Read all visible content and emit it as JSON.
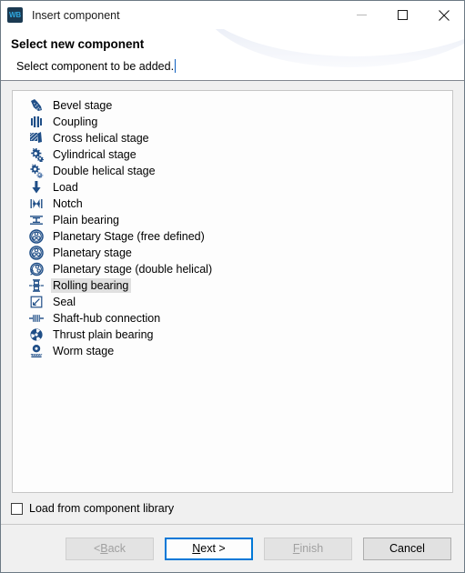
{
  "window": {
    "title": "Insert component",
    "app_icon_text": "WB",
    "controls": [
      {
        "name": "minimize",
        "glyph": "minimize-icon",
        "enabled": false
      },
      {
        "name": "maximize",
        "glyph": "maximize-icon",
        "enabled": true
      },
      {
        "name": "close",
        "glyph": "close-icon",
        "enabled": true
      }
    ]
  },
  "header": {
    "title": "Select new component",
    "subtitle": "Select component to be added."
  },
  "list": {
    "selected_index": 11,
    "items": [
      {
        "label": "Bevel stage",
        "icon": "bevel-gear-icon"
      },
      {
        "label": "Coupling",
        "icon": "coupling-icon"
      },
      {
        "label": "Cross helical stage",
        "icon": "cross-helical-gear-icon"
      },
      {
        "label": "Cylindrical stage",
        "icon": "cylindrical-gear-icon"
      },
      {
        "label": "Double helical stage",
        "icon": "double-helical-gear-icon"
      },
      {
        "label": "Load",
        "icon": "load-arrow-icon"
      },
      {
        "label": "Notch",
        "icon": "notch-icon"
      },
      {
        "label": "Plain bearing",
        "icon": "plain-bearing-icon"
      },
      {
        "label": "Planetary Stage (free defined)",
        "icon": "planetary-stage-icon"
      },
      {
        "label": "Planetary stage",
        "icon": "planetary-stage-icon"
      },
      {
        "label": "Planetary stage (double helical)",
        "icon": "planetary-double-helical-icon"
      },
      {
        "label": "Rolling bearing",
        "icon": "rolling-bearing-icon"
      },
      {
        "label": "Seal",
        "icon": "seal-icon"
      },
      {
        "label": "Shaft-hub connection",
        "icon": "shaft-hub-connection-icon"
      },
      {
        "label": "Thrust plain bearing",
        "icon": "thrust-plain-bearing-icon"
      },
      {
        "label": "Worm stage",
        "icon": "worm-stage-icon"
      }
    ]
  },
  "options": {
    "load_from_library_label": "Load from component library",
    "load_from_library_checked": false
  },
  "buttons": {
    "back": {
      "prefix": "< ",
      "mnemonic": "B",
      "suffix": "ack",
      "enabled": false
    },
    "next": {
      "prefix": "",
      "mnemonic": "N",
      "suffix": "ext >",
      "enabled": true,
      "focused": true
    },
    "finish": {
      "prefix": "",
      "mnemonic": "F",
      "suffix": "inish",
      "enabled": false
    },
    "cancel": {
      "label": "Cancel",
      "enabled": true
    }
  },
  "colors": {
    "accent": "#0078d7",
    "icon_blue": "#1f4e87",
    "title_icon_bg": "#1b3a52",
    "title_icon_fg": "#2fa8e0",
    "dialog_bg": "#f0f0f0",
    "selection": "#e0e0e0"
  }
}
